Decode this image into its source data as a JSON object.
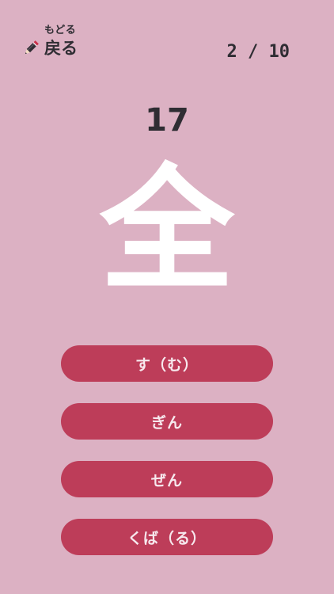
{
  "header": {
    "back": {
      "ruby": "もどる",
      "label": "戻る",
      "icon": "pencil-icon"
    },
    "progress": "2 / 10"
  },
  "quiz": {
    "number": "17",
    "kanji": "全",
    "options": [
      {
        "label": "す（む）"
      },
      {
        "label": "ぎん"
      },
      {
        "label": "ぜん"
      },
      {
        "label": "くば（る）"
      }
    ]
  },
  "colors": {
    "background": "#dcb1c3",
    "option": "#bd3d59",
    "text_dark": "#2f2d33",
    "kanji": "#ffffff"
  }
}
